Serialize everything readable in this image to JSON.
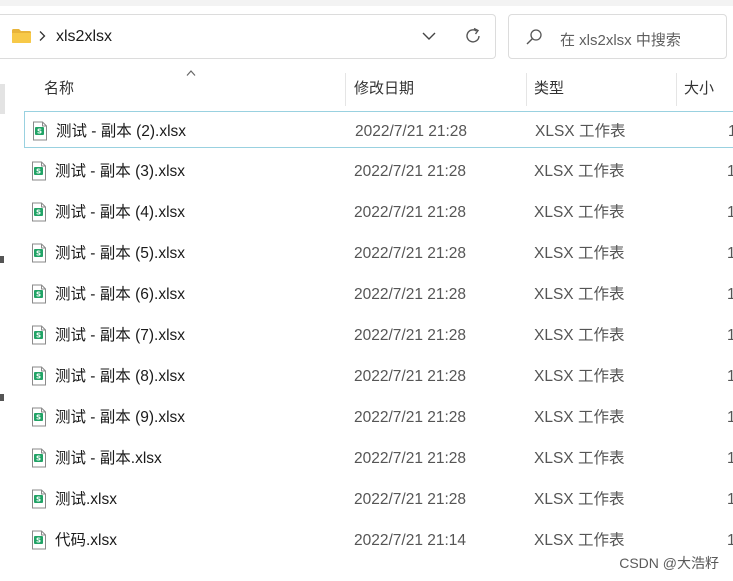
{
  "address": {
    "crumb": "xls2xlsx"
  },
  "search": {
    "placeholder": "在 xls2xlsx 中搜索"
  },
  "columns": {
    "name": "名称",
    "date": "修改日期",
    "type": "类型",
    "size": "大小"
  },
  "files": [
    {
      "name": "测试 - 副本 (2).xlsx",
      "date": "2022/7/21 21:28",
      "type": "XLSX 工作表",
      "size": "1"
    },
    {
      "name": "测试 - 副本 (3).xlsx",
      "date": "2022/7/21 21:28",
      "type": "XLSX 工作表",
      "size": "1"
    },
    {
      "name": "测试 - 副本 (4).xlsx",
      "date": "2022/7/21 21:28",
      "type": "XLSX 工作表",
      "size": "1"
    },
    {
      "name": "测试 - 副本 (5).xlsx",
      "date": "2022/7/21 21:28",
      "type": "XLSX 工作表",
      "size": "1"
    },
    {
      "name": "测试 - 副本 (6).xlsx",
      "date": "2022/7/21 21:28",
      "type": "XLSX 工作表",
      "size": "1"
    },
    {
      "name": "测试 - 副本 (7).xlsx",
      "date": "2022/7/21 21:28",
      "type": "XLSX 工作表",
      "size": "1"
    },
    {
      "name": "测试 - 副本 (8).xlsx",
      "date": "2022/7/21 21:28",
      "type": "XLSX 工作表",
      "size": "1"
    },
    {
      "name": "测试 - 副本 (9).xlsx",
      "date": "2022/7/21 21:28",
      "type": "XLSX 工作表",
      "size": "1"
    },
    {
      "name": "测试 - 副本.xlsx",
      "date": "2022/7/21 21:28",
      "type": "XLSX 工作表",
      "size": "1"
    },
    {
      "name": "测试.xlsx",
      "date": "2022/7/21 21:28",
      "type": "XLSX 工作表",
      "size": "1"
    },
    {
      "name": "代码.xlsx",
      "date": "2022/7/21 21:14",
      "type": "XLSX 工作表",
      "size": "1"
    }
  ],
  "watermark": "CSDN @大浩籽",
  "colors": {
    "selected_border": "#99d1e0",
    "excel_green": "#21a366",
    "folder_yellow": "#f7c948"
  }
}
